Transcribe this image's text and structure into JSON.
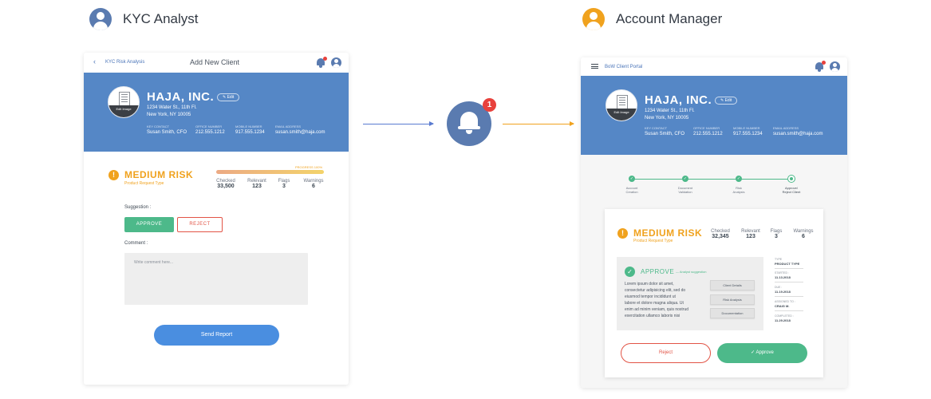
{
  "colors": {
    "brand_blue": "#5587c6",
    "avatar_blue": "#5a7bb0",
    "accent_orange": "#f0a21e",
    "approve_green": "#4db98a",
    "reject_red": "#e25446",
    "badge_red": "#e8413c",
    "send_blue": "#4a8ee0"
  },
  "roles": {
    "left": {
      "label": "KYC Analyst",
      "icon": "user-avatar-icon",
      "color": "#5a7bb0"
    },
    "right": {
      "label": "Account Manager",
      "icon": "user-avatar-icon",
      "color": "#f0a21e"
    }
  },
  "notification": {
    "icon": "bell-icon",
    "badge": "1"
  },
  "client": {
    "name": "HAJA, INC.",
    "edit_label": "Edit",
    "logo_edit_label": "Edit Image",
    "address_line1": "1234 Water St., 11th Fl.",
    "address_line2": "New York, NY 10005",
    "contacts": [
      {
        "label": "KEY CONTACT",
        "value": "Susan Smith, CFO"
      },
      {
        "label": "OFFICE NUMBER",
        "value": "212.555.1212"
      },
      {
        "label": "MOBILE NUMBER",
        "value": "917.555.1234"
      },
      {
        "label": "EMAIL ADDRESS",
        "value": "susan.smith@haja.com"
      }
    ]
  },
  "left_panel": {
    "back_label": "KYC Risk Analysis",
    "title": "Add New Client",
    "risk": {
      "title": "MEDIUM RISK",
      "subtitle": "Product Request Type",
      "progress_label": "PROGRESS 100%",
      "progress": 1.0,
      "stats": [
        {
          "label": "Checked",
          "value": "33,500"
        },
        {
          "label": "Relevant",
          "value": "123"
        },
        {
          "label": "Flags",
          "value": "3"
        },
        {
          "label": "Warnings",
          "value": "6"
        }
      ]
    },
    "suggestion_label": "Suggestion :",
    "approve_label": "APPROVE",
    "reject_label": "REJECT",
    "comment_label": "Comment :",
    "comment_placeholder": "Write comment here...",
    "send_label": "Send Report"
  },
  "right_panel": {
    "portal_label": "BoW Client Portal",
    "steps": [
      {
        "label_1": "Account",
        "label_2": "Creation",
        "state": "done"
      },
      {
        "label_1": "Document",
        "label_2": "Validation",
        "state": "done"
      },
      {
        "label_1": "Risk",
        "label_2": "Analysis",
        "state": "done"
      },
      {
        "label_1": "Approve/",
        "label_2": "Reject Client",
        "state": "current"
      }
    ],
    "risk": {
      "title": "MEDIUM RISK",
      "subtitle": "Product Request Type",
      "stats": [
        {
          "label": "Checked",
          "value": "32,345"
        },
        {
          "label": "Relevant",
          "value": "123"
        },
        {
          "label": "Flags",
          "value": "3"
        },
        {
          "label": "Warnings",
          "value": "6"
        }
      ]
    },
    "approve_title": "APPROVE",
    "approve_suggestion": "Analyst suggestion",
    "lorem_lines": [
      "Lorem ipsum dolor sit amet,",
      "consectetur adipisicing elit, sed do",
      "eiusmod tempor incididunt ut",
      "labore et dolore magna aliqua. Ut",
      "enim ad minim veniam, quis nostrud",
      "exercitation ullamco laboris nisi"
    ],
    "side_buttons": [
      "Client Details",
      "Risk Analysis",
      "Documentation"
    ],
    "meta": [
      {
        "label": "TYPE",
        "value": "PRODUCT TYPE"
      },
      {
        "label": "STARTED :",
        "value": "11.13.2018"
      },
      {
        "label": "DUE :",
        "value": "11.19.2018"
      },
      {
        "label": "ASSIGNED TO :",
        "value": "CRAIG M."
      },
      {
        "label": "COMPLETED :",
        "value": "11.29.2018"
      }
    ],
    "reject_label": "Reject",
    "approve_label": "Approve"
  }
}
